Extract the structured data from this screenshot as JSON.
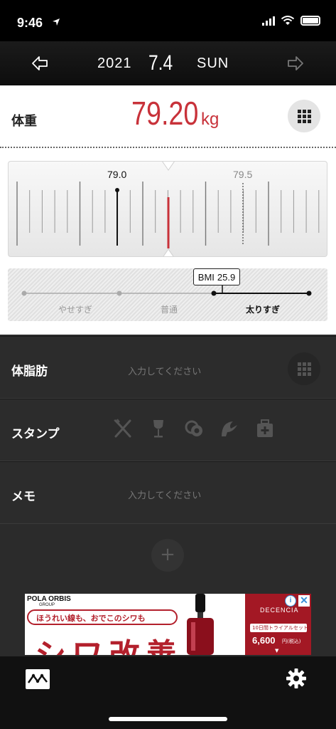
{
  "status_bar": {
    "time": "9:46"
  },
  "nav": {
    "year": "2021",
    "date": "7.4",
    "day_of_week": "SUN",
    "prev_icon": "arrow-left-icon",
    "next_icon": "arrow-right-icon"
  },
  "weight": {
    "label": "体重",
    "value": "79.20",
    "unit": "kg",
    "keypad_icon": "keypad-icon"
  },
  "scale": {
    "marker_left": "79.0",
    "marker_right": "79.5"
  },
  "bmi": {
    "tag_label": "BMI",
    "tag_value": "25.9",
    "categories": [
      "やせすぎ",
      "普通",
      "太りすぎ"
    ],
    "active_category": "太りすぎ"
  },
  "rows": {
    "body_fat": {
      "label": "体脂肪",
      "placeholder": "入力してください"
    },
    "stamp": {
      "label": "スタンプ",
      "icons": [
        "fork-knife-icon",
        "wine-glass-icon",
        "coins-icon",
        "runner-icon",
        "medicine-box-icon"
      ]
    },
    "memo": {
      "label": "メモ",
      "placeholder": "入力してください"
    }
  },
  "ad": {
    "brand": "POLA ORBIS",
    "brand_sub": "GROUP",
    "headline": "ほうれい線も、おでこのシワも",
    "big_text": "シワ改善",
    "right_brand": "DECENCIA",
    "trial": "10日間トライアルセット",
    "price": "6,600",
    "price_suffix": "円(税込)"
  },
  "colors": {
    "accent": "#c8323a",
    "panel": "#ffffff",
    "dark": "#2c2c2c"
  }
}
